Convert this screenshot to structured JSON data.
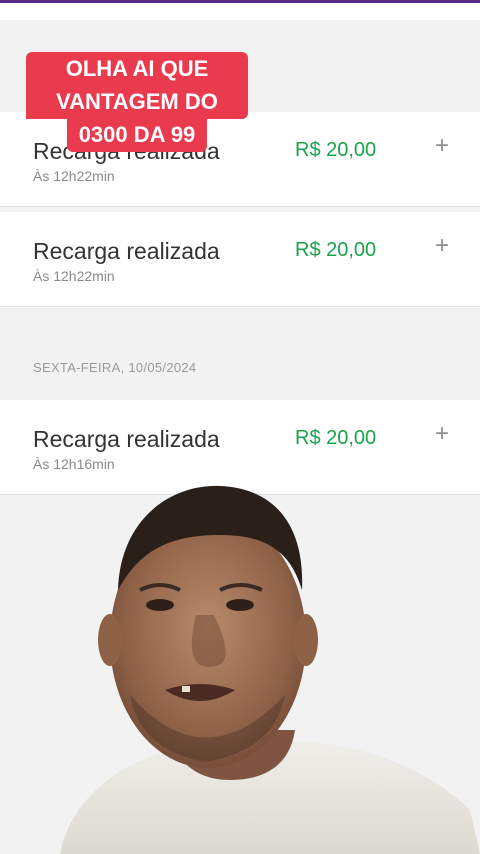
{
  "overlay": {
    "lines": [
      "OLHA AI QUE",
      "VANTAGEM DO",
      "0300 DA 99"
    ]
  },
  "transactions": [
    {
      "title": "Recarga realizada",
      "time": "Às 12h22min",
      "amount": "R$ 20,00",
      "action": "+"
    },
    {
      "title": "Recarga realizada",
      "time": "Às 12h22min",
      "amount": "R$ 20,00",
      "action": "+"
    }
  ],
  "section": {
    "date_label": "SEXTA-FEIRA, 10/05/2024",
    "transactions": [
      {
        "title": "Recarga realizada",
        "time": "Às 12h16min",
        "amount": "R$ 20,00",
        "action": "+"
      }
    ]
  },
  "colors": {
    "amount_green": "#1aa34a",
    "overlay_red": "#ea3a4e",
    "top_bar": "#5b2a86"
  },
  "icons": [
    "plus-icon"
  ]
}
